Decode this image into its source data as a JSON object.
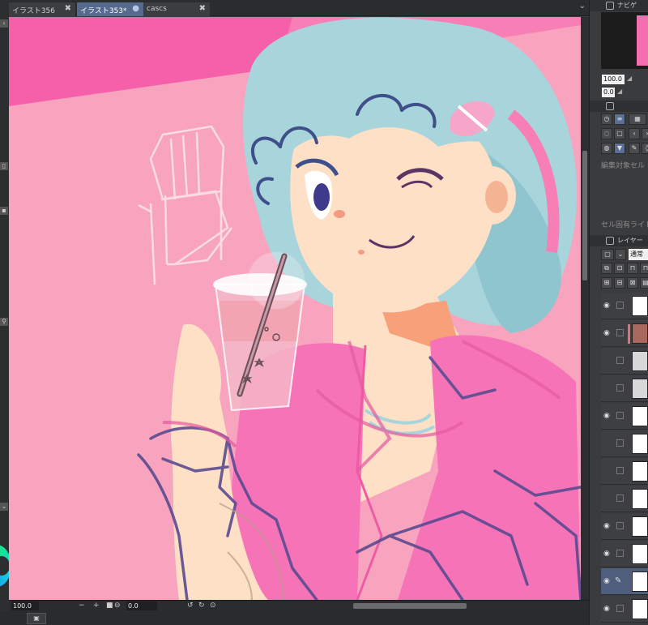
{
  "tabs": [
    {
      "label": "イラスト356",
      "close": "✖",
      "active": false
    },
    {
      "label": "イラスト353*",
      "close": "●",
      "active": true
    },
    {
      "label": "cascs",
      "close": "✖",
      "active": false
    }
  ],
  "tab_overflow_icon": "chevron-down-icon",
  "status": {
    "zoom_value": "100.0",
    "minus": "−",
    "plus": "+",
    "rotation_value": "0.0"
  },
  "right_panel": {
    "navigator_title": "ナビゲ",
    "navigator_zoom": "100.0",
    "navigator_rotation": "0.0",
    "sub_tool_hint": "編集対象セル",
    "cell_label": "セル固有ライト",
    "layer_title": "レイヤー",
    "blend_mode": "通常"
  },
  "layers": [
    {
      "visible": true,
      "thumb": "white"
    },
    {
      "visible": true,
      "thumb": "brown",
      "clipped": true
    },
    {
      "visible": false,
      "thumb": "gray"
    },
    {
      "visible": false,
      "thumb": "gray-folder"
    },
    {
      "visible": true,
      "thumb": "white"
    },
    {
      "visible": false,
      "thumb": "white"
    },
    {
      "visible": false,
      "thumb": "white"
    },
    {
      "visible": false,
      "thumb": "white"
    },
    {
      "visible": true,
      "thumb": "white"
    },
    {
      "visible": true,
      "thumb": "white"
    },
    {
      "visible": true,
      "thumb": "white",
      "selected": true,
      "editing": true
    },
    {
      "visible": true,
      "thumb": "white"
    }
  ],
  "colors": {
    "canvas_pink": "#f8a4bf",
    "accent_pink": "#f65faa",
    "hair_blue": "#a8d4dc",
    "shirt_pink": "#f773b8",
    "skin": "#fde0c6",
    "outline_purple": "#5b4b8f"
  }
}
